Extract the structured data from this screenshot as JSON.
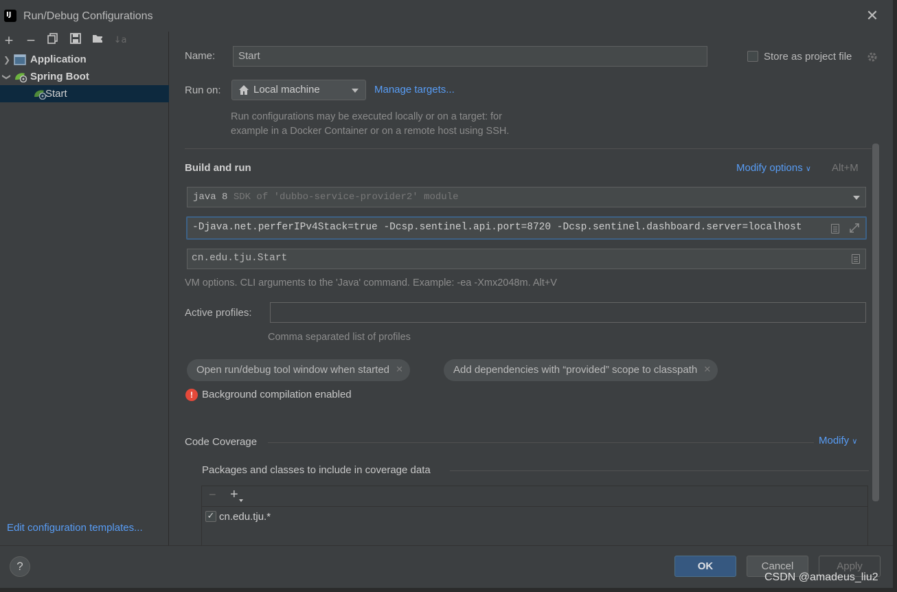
{
  "window": {
    "title": "Run/Debug Configurations"
  },
  "toolbar": {
    "add": "+",
    "remove": "−",
    "copy": "⧉",
    "save": "💾",
    "folder": "📁",
    "sort": "↓a"
  },
  "tree": {
    "items": [
      {
        "label": "Application",
        "expanded": false
      },
      {
        "label": "Spring Boot",
        "expanded": true
      },
      {
        "label": "Start",
        "selected": true
      }
    ]
  },
  "left_footer": {
    "edit_templates": "Edit configuration templates..."
  },
  "form": {
    "name_label": "Name:",
    "name_value": "Start",
    "store_as_project_file": "Store as project file",
    "run_on_label": "Run on:",
    "run_on_value": "Local machine",
    "manage_targets": "Manage targets...",
    "run_on_hint_line1": "Run configurations may be executed locally or on a target: for",
    "run_on_hint_line2": "example in a Docker Container or on a remote host using SSH.",
    "build_and_run_title": "Build and run",
    "modify_options": "Modify options",
    "modify_options_shortcut": "Alt+M",
    "jdk_main": "java 8",
    "jdk_dim": "SDK of 'dubbo-service-provider2' module",
    "vm_options_value": "-Djava.net.perferIPv4Stack=true -Dcsp.sentinel.api.port=8720 -Dcsp.sentinel.dashboard.server=localhost",
    "main_class_value": "cn.edu.tju.Start",
    "vm_hint": "VM options. CLI arguments to the 'Java' command. Example: -ea -Xmx2048m. Alt+V",
    "active_profiles_label": "Active profiles:",
    "active_profiles_value": "",
    "active_profiles_hint": "Comma separated list of profiles",
    "chips": [
      "Open run/debug tool window when started",
      "Add dependencies with “provided” scope to classpath"
    ],
    "background_compilation": "Background compilation enabled",
    "code_coverage_title": "Code Coverage",
    "code_coverage_modify": "Modify",
    "coverage_packages_title": "Packages and classes to include in coverage data",
    "coverage_entries": [
      {
        "pattern": "cn.edu.tju.*",
        "checked": true
      }
    ]
  },
  "buttons": {
    "help": "?",
    "ok": "OK",
    "cancel": "Cancel",
    "apply": "Apply"
  },
  "watermark": "CSDN @amadeus_liu2",
  "colors": {
    "accent": "#589df6",
    "selection": "#0d293e",
    "ok": "#365880",
    "error": "#e5493a"
  }
}
